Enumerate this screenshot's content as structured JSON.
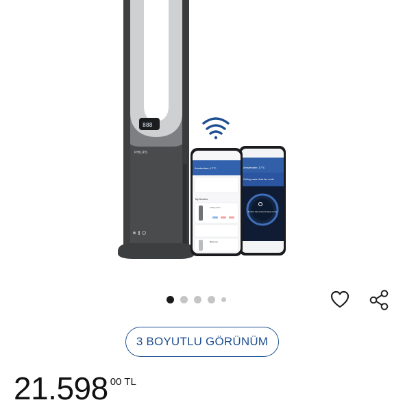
{
  "gallery": {
    "brand": "PHILIPS",
    "device_display": "888",
    "phone_left": {
      "location": "Amsterdam, 17°C",
      "section": "My Devices",
      "device1": "Living room",
      "device2": "Bedroom"
    },
    "phone_right": {
      "location": "Amsterdam, 17°C",
      "banner": "Ceiling mode: Auto fan mode",
      "ring_text": "Device has entered sleep mode"
    },
    "dots": [
      {
        "active": true
      },
      {
        "active": false
      },
      {
        "active": false
      },
      {
        "active": false
      },
      {
        "active": false,
        "small": true
      }
    ]
  },
  "actions": {
    "favorite_icon": "heart-outline-icon",
    "share_icon": "share-icon"
  },
  "view3d": {
    "label": "3 BOYUTLU GÖRÜNÜM"
  },
  "price": {
    "main": "21.598",
    "decimals": "00",
    "currency": "TL"
  },
  "colors": {
    "accent": "#1d4f91",
    "device": "#4a4b4d",
    "wifi": "#1d4f91"
  }
}
